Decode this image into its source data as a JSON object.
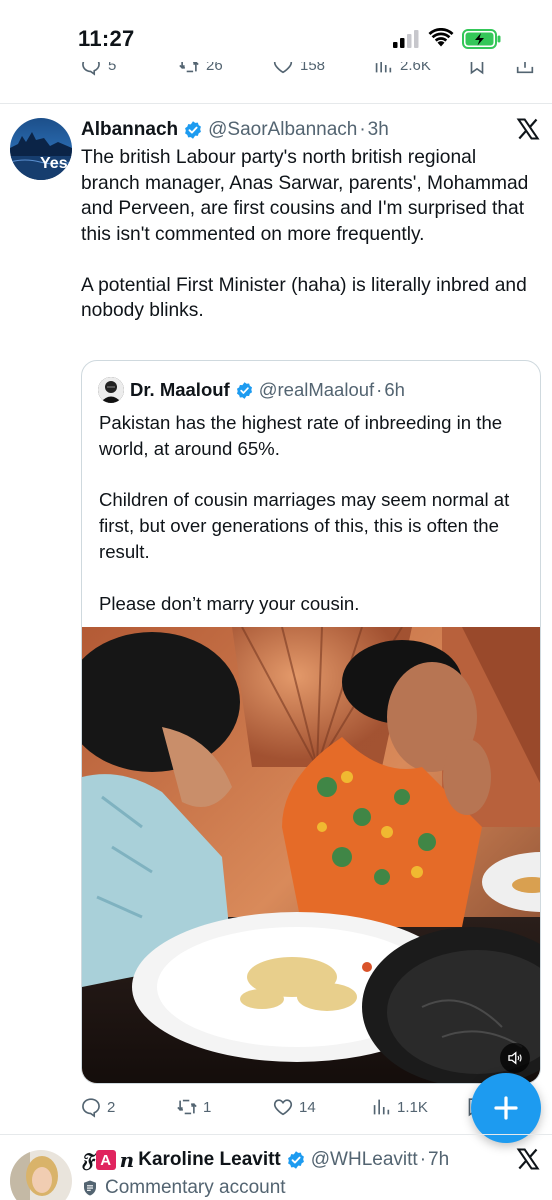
{
  "status_bar": {
    "time": "11:27"
  },
  "previous_tweet": {
    "replies": "5",
    "retweets": "26",
    "likes": "158",
    "views": "2.6K"
  },
  "tweet": {
    "author_name": "Albannach",
    "handle": "@SaorAlbannach",
    "separator": "·",
    "time": "3h",
    "avatar_text": "Yes",
    "text": "The british Labour party's north british regional branch manager, Anas Sarwar, parents', Mohammad and Perveen, are first cousins and I'm surprised that this isn't commented on more frequently.\n\nA potential First Minister (haha) is literally inbred and nobody blinks.",
    "quote": {
      "author_name": "Dr. Maalouf",
      "handle": "@realMaalouf",
      "separator": "·",
      "time": "6h",
      "text": "Pakistan has the highest rate of inbreeding in the world, at around 65%.\n\nChildren of cousin marriages may seem normal at first, but over generations of this, this is often the result.\n\nPlease don’t marry your cousin."
    },
    "actions": {
      "replies": "2",
      "retweets": "1",
      "likes": "14",
      "views": "1.1K"
    }
  },
  "next_tweet": {
    "author_name": "Karoline Leavitt",
    "handle": "@WHLeavitt",
    "separator": "·",
    "time": "7h",
    "badge_fraktur": "𝔉",
    "badge_a": "A",
    "badge_n": "n",
    "subtitle": "Commentary account"
  },
  "colors": {
    "accent": "#1d9bf0",
    "text": "#0f1419",
    "secondary": "#536471",
    "border": "#cfd9de"
  },
  "icons": [
    "signal-icon",
    "wifi-icon",
    "battery-charging-icon",
    "verified-icon",
    "x-logo-icon",
    "reply-icon",
    "retweet-icon",
    "like-icon",
    "views-icon",
    "bookmark-icon",
    "share-icon",
    "compose-icon",
    "mute-icon",
    "shield-icon"
  ]
}
